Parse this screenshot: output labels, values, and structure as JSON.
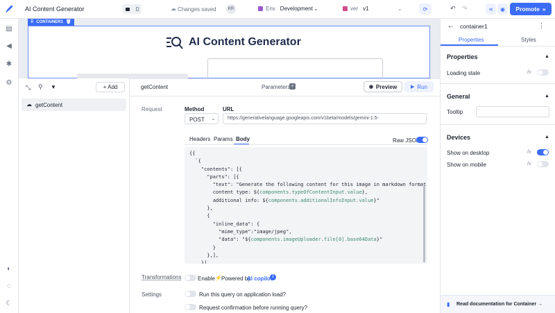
{
  "app": {
    "title": "AI Content Generator",
    "save_status": "Changes saved",
    "avatar_initials": "KR",
    "env_label": "Env",
    "env_value": "Development",
    "version_label": "ver",
    "version_value": "v1",
    "promote_label": "Promote"
  },
  "canvas": {
    "container_label": "CONTAINER1",
    "heading": "AI Content Generator"
  },
  "query_list": {
    "add_label": "+ Add",
    "items": [
      {
        "name": "getContent"
      }
    ]
  },
  "query_editor": {
    "name": "getContent",
    "parameters_label": "Parameters",
    "preview_label": "Preview",
    "run_label": "Run",
    "request_label": "Request",
    "method_label": "Method",
    "method_value": "POST",
    "url_label": "URL",
    "url_value": "https://generativelanguage.googleapis.com/v1beta/models/gemini-1.5-",
    "tabs": [
      "Headers",
      "Params",
      "Body"
    ],
    "active_tab": "Body",
    "raw_json_label": "Raw JSON",
    "body_lines": [
      "{{",
      "  `{",
      "    \"contents\": [{",
      "      \"parts\": [{",
      "        \"text\": \"Generate the following content for this image in markdown format:",
      "        content type: ${components.typeOfContentInput.value},",
      "        additional info: ${components.additionalInfoInput.value}\"",
      "      },",
      "      {",
      "        \"inline_data\": {",
      "          \"mime_type\":\"image/jpeg\",",
      "          \"data\": \"${components.imageUploader.file[0].base64Data}\"",
      "        }",
      "      },],",
      "    }],"
    ],
    "transformations_label": "Transformations",
    "enable_label": "Enable",
    "powered_by_label": "Powered by",
    "ai_copilot_label": "AI copilot",
    "settings_label": "Settings",
    "run_on_load_label": "Run this query on application load?",
    "confirm_label": "Request confirmation before running query?"
  },
  "inspector": {
    "component_name": "container1",
    "tabs": [
      "Properties",
      "Styles"
    ],
    "active_tab": "Properties",
    "sections": {
      "properties": "Properties",
      "loading_state": "Loading state",
      "general": "General",
      "tooltip": "Tooltip",
      "devices": "Devices",
      "show_desktop": "Show on desktop",
      "show_mobile": "Show on mobile"
    },
    "fx_label": "fx",
    "docs_link": "Read documentation for Container →"
  },
  "colors": {
    "accent": "#3b6cf6",
    "highlight": "#3a8a6e"
  }
}
